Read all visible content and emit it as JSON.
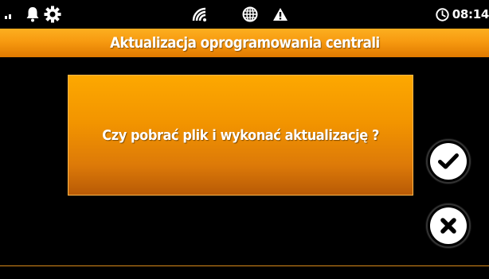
{
  "status_bar": {
    "time": "08:14",
    "icons": [
      "signal-icon",
      "bell-icon",
      "gear-icon",
      "wifi-icon",
      "globe-icon",
      "warning-icon",
      "clock-icon"
    ]
  },
  "header": {
    "title": "Aktualizacja oprogramowania centrali"
  },
  "dialog": {
    "question": "Czy pobrać plik i wykonać aktualizację ?"
  },
  "buttons": {
    "confirm_icon": "checkmark-icon",
    "cancel_icon": "close-icon"
  },
  "colors": {
    "accent": "#f79a10",
    "background": "#000000",
    "text": "#ffffff"
  }
}
